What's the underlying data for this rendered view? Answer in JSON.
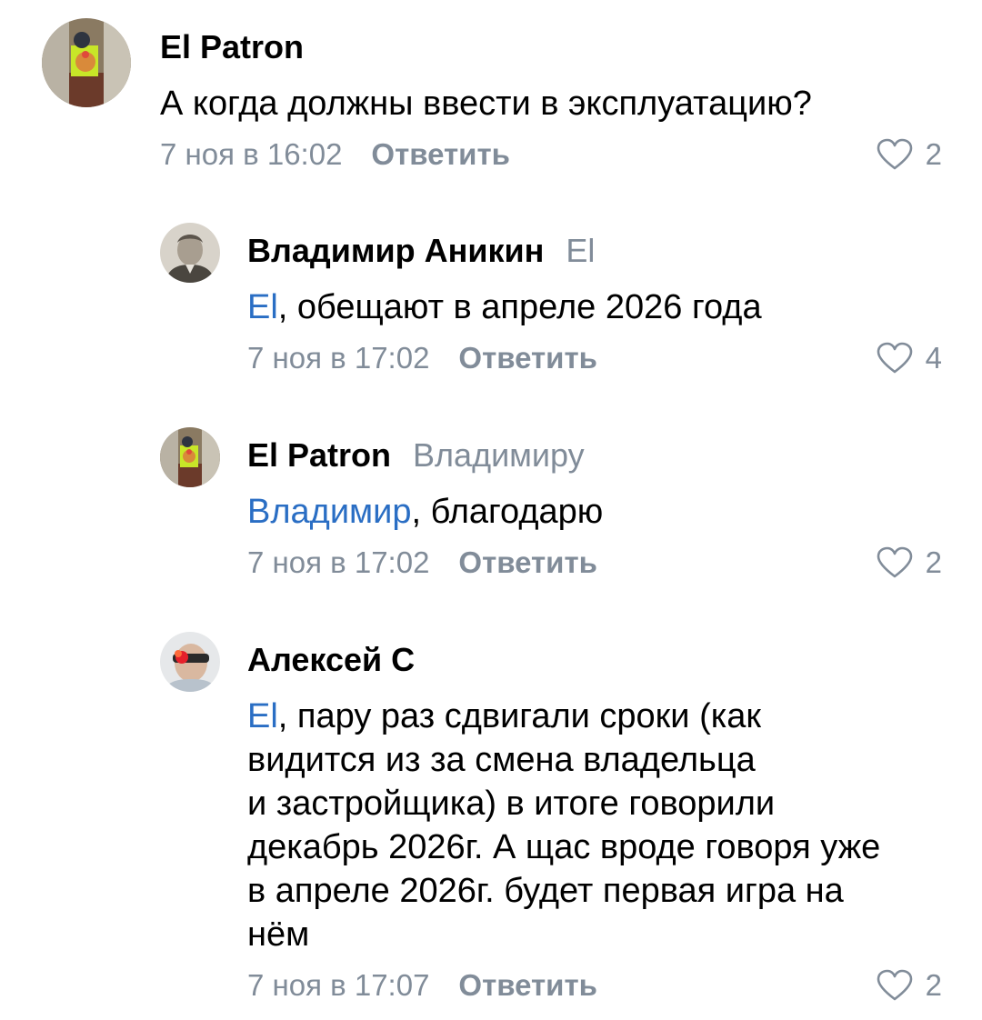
{
  "comments": [
    {
      "author": "El Patron",
      "reply_to": "",
      "mention": "",
      "text": "А когда должны ввести в эксплуатацию?",
      "time": "7 ноя в 16:02",
      "reply_label": "Ответить",
      "likes": "2"
    },
    {
      "author": "Владимир Аникин",
      "reply_to": "El",
      "mention": "El",
      "text": ", обещают в апреле 2026 года",
      "time": "7 ноя в 17:02",
      "reply_label": "Ответить",
      "likes": "4"
    },
    {
      "author": "El Patron",
      "reply_to": "Владимиру",
      "mention": "Владимир",
      "text": ", благодарю",
      "time": "7 ноя в 17:02",
      "reply_label": "Ответить",
      "likes": "2"
    },
    {
      "author": "Алексей С",
      "reply_to": "",
      "mention": "El",
      "text_lines": [
        ", пару раз сдвигали сроки (как",
        "видится из за смена владельца",
        "и застройщика) в итоге говорили",
        "декабрь 2026г. А щас вроде говоря уже",
        "в апреле 2026г. будет первая игра на",
        "нём"
      ],
      "time": "7 ноя в 17:07",
      "reply_label": "Ответить",
      "likes": "2"
    }
  ],
  "colors": {
    "link": "#2a6ec4",
    "secondary": "#818c99",
    "text": "#000000"
  },
  "icons": {
    "like": "heart-outline-icon"
  }
}
